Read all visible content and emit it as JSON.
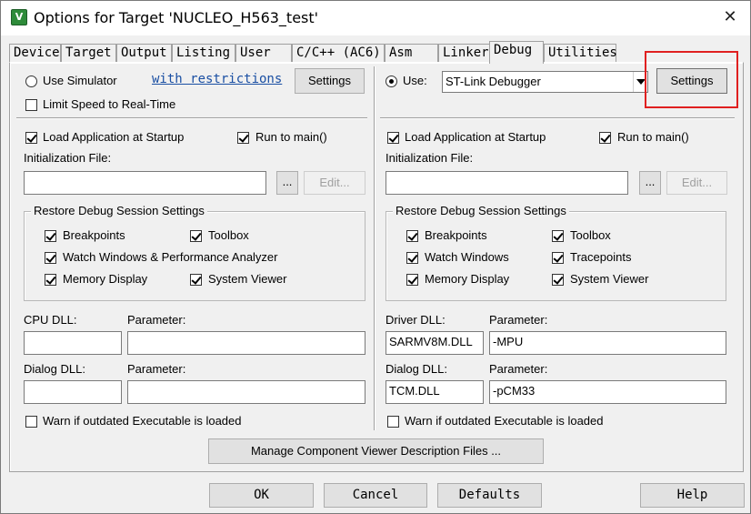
{
  "window": {
    "title": "Options for Target 'NUCLEO_H563_test'",
    "icon_glyph": "V",
    "close_glyph": "✕"
  },
  "tabs": [
    {
      "label": "Device"
    },
    {
      "label": "Target"
    },
    {
      "label": "Output"
    },
    {
      "label": "Listing"
    },
    {
      "label": "User"
    },
    {
      "label": "C/C++ (AC6)"
    },
    {
      "label": "Asm"
    },
    {
      "label": "Linker"
    },
    {
      "label": "Debug",
      "active": true
    },
    {
      "label": "Utilities"
    }
  ],
  "left": {
    "use_simulator": {
      "label": "Use Simulator",
      "checked": false
    },
    "restrictions_link": "with restrictions",
    "settings_label": "Settings",
    "limit_speed": {
      "label": "Limit Speed to Real-Time",
      "checked": false
    },
    "load_app": {
      "label": "Load Application at Startup",
      "checked": true
    },
    "run_to_main": {
      "label": "Run to main()",
      "checked": true
    },
    "init_file_label": "Initialization File:",
    "init_file_value": "",
    "browse_label": "...",
    "edit_label": "Edit...",
    "restore_group_title": "Restore Debug Session Settings",
    "restore": {
      "breakpoints": {
        "label": "Breakpoints",
        "checked": true
      },
      "toolbox": {
        "label": "Toolbox",
        "checked": true
      },
      "watch": {
        "label": "Watch Windows & Performance Analyzer",
        "checked": true
      },
      "memory": {
        "label": "Memory Display",
        "checked": true
      },
      "system_viewer": {
        "label": "System Viewer",
        "checked": true
      }
    },
    "cpu_dll_label": "CPU DLL:",
    "cpu_dll_value": "",
    "cpu_param_label": "Parameter:",
    "cpu_param_value": "",
    "dialog_dll_label": "Dialog DLL:",
    "dialog_dll_value": "",
    "dialog_param_label": "Parameter:",
    "dialog_param_value": "",
    "warn": {
      "label": "Warn if outdated Executable is loaded",
      "checked": false
    }
  },
  "right": {
    "use": {
      "label": "Use:",
      "checked": true
    },
    "debugger_select": "ST-Link Debugger",
    "settings_label": "Settings",
    "load_app": {
      "label": "Load Application at Startup",
      "checked": true
    },
    "run_to_main": {
      "label": "Run to main()",
      "checked": true
    },
    "init_file_label": "Initialization File:",
    "init_file_value": "",
    "browse_label": "...",
    "edit_label": "Edit...",
    "restore_group_title": "Restore Debug Session Settings",
    "restore": {
      "breakpoints": {
        "label": "Breakpoints",
        "checked": true
      },
      "toolbox": {
        "label": "Toolbox",
        "checked": true
      },
      "watch": {
        "label": "Watch Windows",
        "checked": true
      },
      "tracepoints": {
        "label": "Tracepoints",
        "checked": true
      },
      "memory": {
        "label": "Memory Display",
        "checked": true
      },
      "system_viewer": {
        "label": "System Viewer",
        "checked": true
      }
    },
    "driver_dll_label": "Driver DLL:",
    "driver_dll_value": "SARMV8M.DLL",
    "driver_param_label": "Parameter:",
    "driver_param_value": "-MPU",
    "dialog_dll_label": "Dialog DLL:",
    "dialog_dll_value": "TCM.DLL",
    "dialog_param_label": "Parameter:",
    "dialog_param_value": "-pCM33",
    "warn": {
      "label": "Warn if outdated Executable is loaded",
      "checked": false
    }
  },
  "manage_button": "Manage Component Viewer Description Files ...",
  "footer": {
    "ok": "OK",
    "cancel": "Cancel",
    "defaults": "Defaults",
    "help": "Help"
  },
  "colors": {
    "highlight": "#e02020",
    "link": "#1a4fa3",
    "dialog_bg": "#f0f0f0"
  }
}
